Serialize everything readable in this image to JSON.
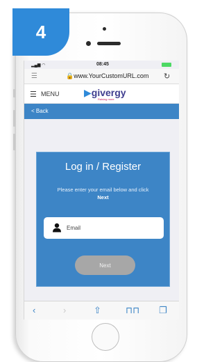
{
  "step_badge": "4",
  "status_bar": {
    "time": "08:45"
  },
  "browser": {
    "url": "www.YourCustomURL.com"
  },
  "site_nav": {
    "menu_label": "MENU",
    "logo_text": "givergy",
    "logo_tagline": "Raising more"
  },
  "back": {
    "label": "< Back"
  },
  "login": {
    "title": "Log in / Register",
    "instruction": "Please enter your email below and click",
    "instruction_bold": "Next",
    "email_placeholder": "Email",
    "next_label": "Next"
  },
  "colors": {
    "accent": "#3d85c6",
    "badge": "#2f8ad9",
    "button_disabled": "#a7a7a7"
  }
}
